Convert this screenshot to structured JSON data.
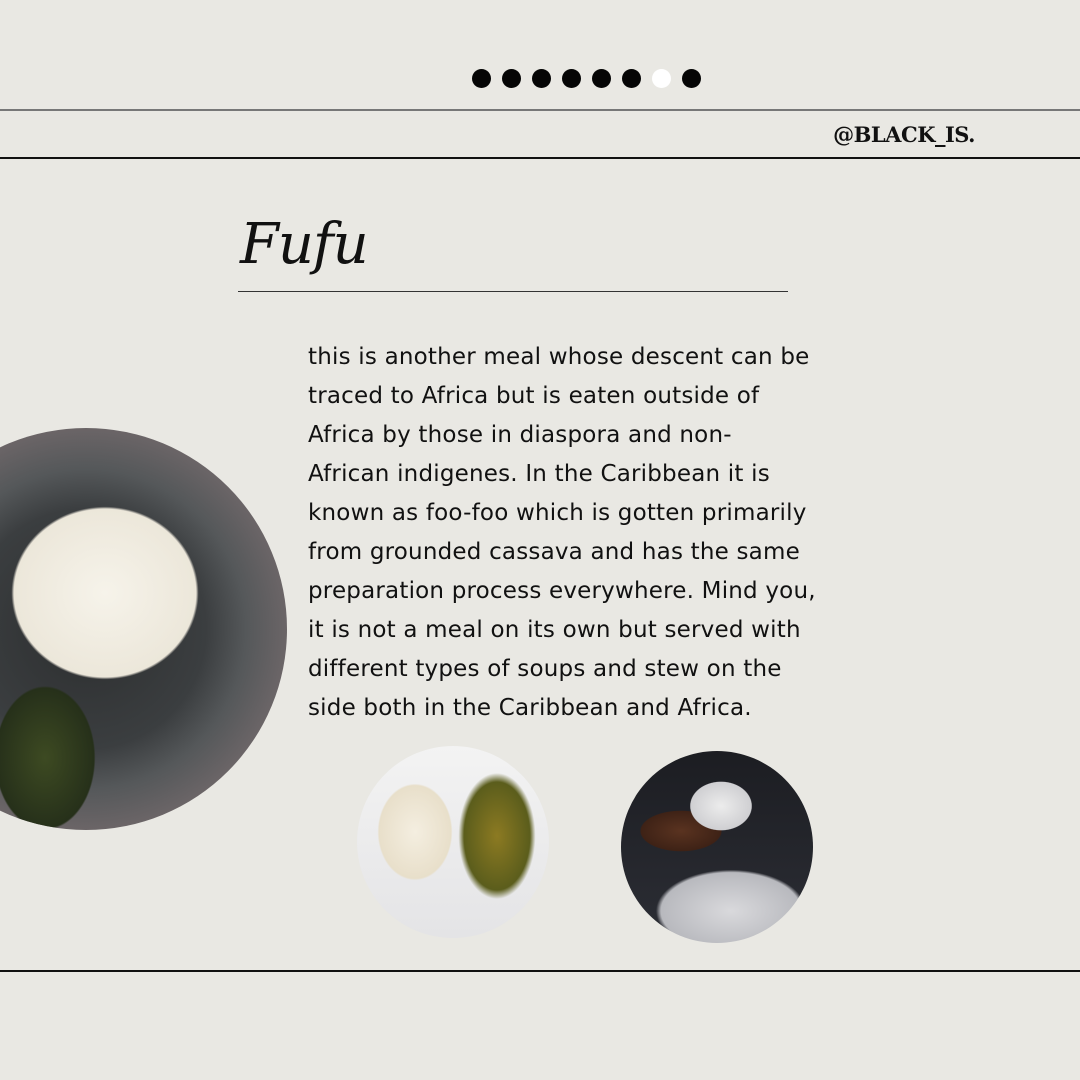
{
  "pagination": {
    "total": 8,
    "active_index": 6
  },
  "handle": "@BLACK_IS.",
  "title": "Fufu",
  "body_lines": [
    "this is another meal whose descent can be",
    "traced to Africa but is eaten outside of",
    "Africa by those in diaspora and non-",
    "African indigenes. In the Caribbean it is",
    "known as foo-foo which is gotten primarily",
    "from grounded cassava and has the same",
    "preparation process everywhere. Mind you,",
    "it is not a meal on its own but served with",
    "different types of soups and stew on the",
    "side both in the Caribbean and Africa."
  ],
  "colors": {
    "background": "#e9e8e3",
    "text": "#111111",
    "active_dot": "#ffffff",
    "dot": "#050505"
  }
}
